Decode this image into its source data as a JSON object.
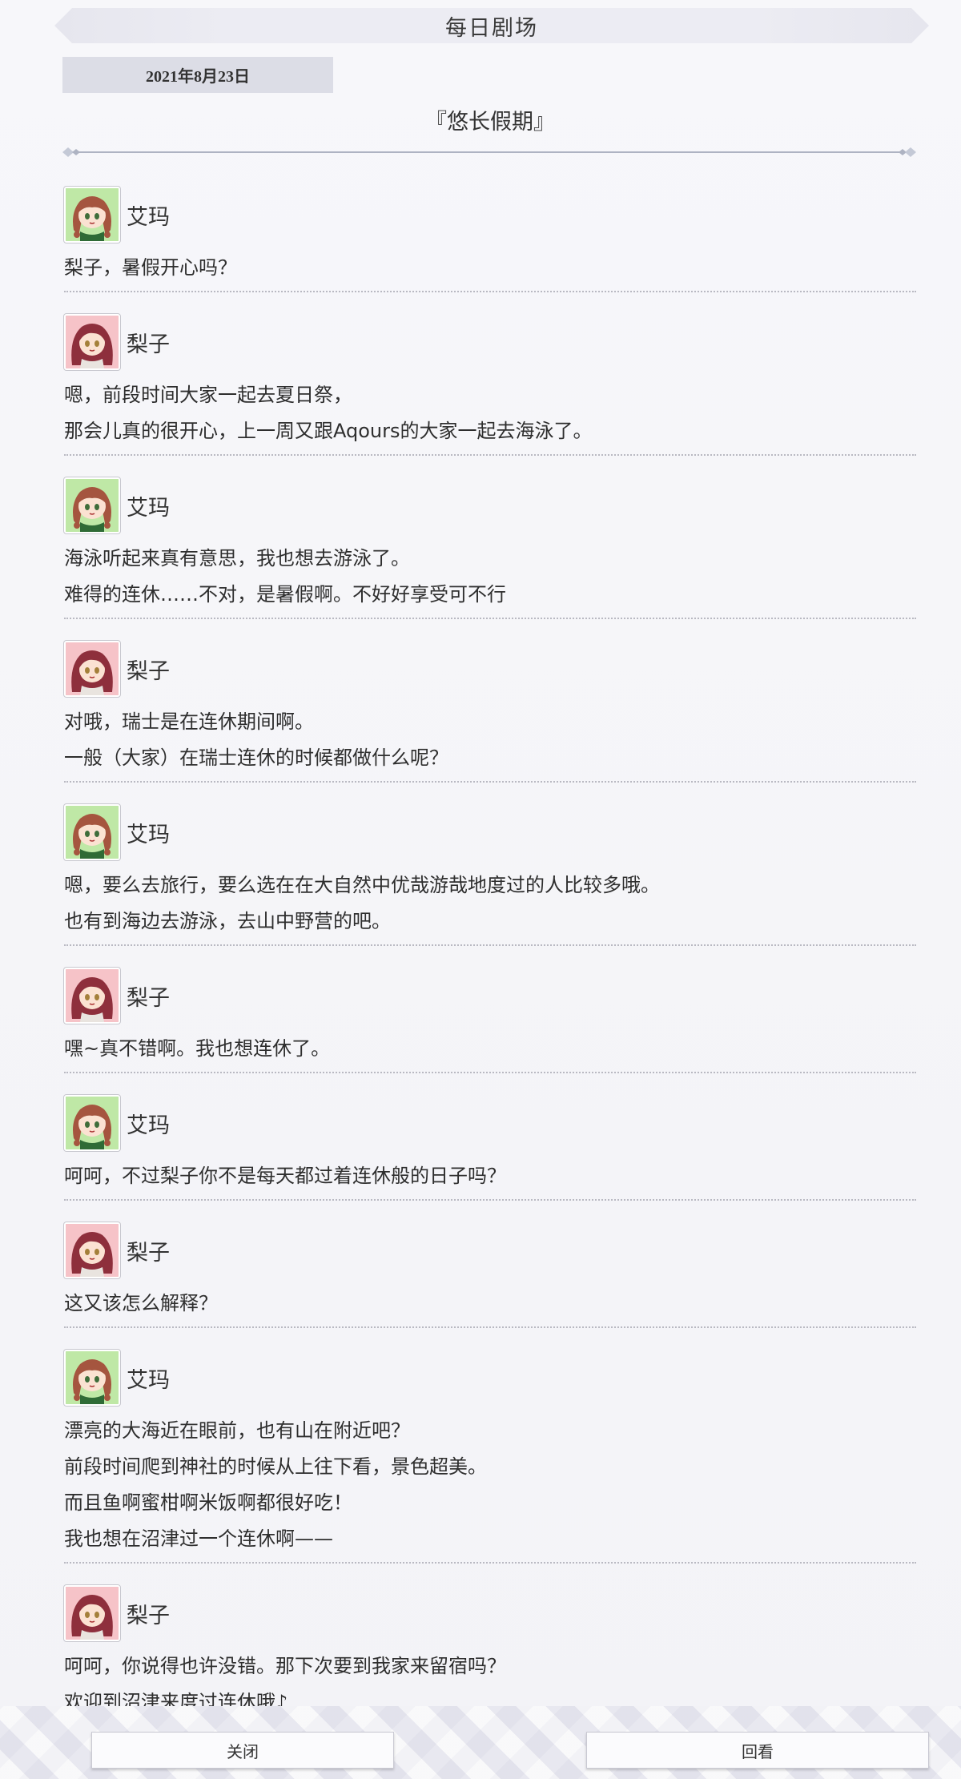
{
  "header": {
    "title": "每日剧场"
  },
  "date": "2021年8月23日",
  "episode_title": "『悠长假期』",
  "colors": {
    "emma_avatar_bg": "#bfe8a6",
    "riko_avatar_bg": "#f6c3c8"
  },
  "entries": [
    {
      "speaker": "艾玛",
      "avatar": "emma-avatar",
      "lines": [
        "梨子，暑假开心吗？"
      ]
    },
    {
      "speaker": "梨子",
      "avatar": "riko-avatar",
      "lines": [
        "嗯，前段时间大家一起去夏日祭，",
        "那会儿真的很开心，上一周又跟Aqours的大家一起去海泳了。"
      ]
    },
    {
      "speaker": "艾玛",
      "avatar": "emma-avatar",
      "lines": [
        "海泳听起来真有意思，我也想去游泳了。",
        "难得的连休……不对，是暑假啊。不好好享受可不行"
      ]
    },
    {
      "speaker": "梨子",
      "avatar": "riko-avatar",
      "lines": [
        "对哦，瑞士是在连休期间啊。",
        "一般（大家）在瑞士连休的时候都做什么呢？"
      ]
    },
    {
      "speaker": "艾玛",
      "avatar": "emma-avatar",
      "lines": [
        "嗯，要么去旅行，要么选在在大自然中优哉游哉地度过的人比较多哦。",
        "也有到海边去游泳，去山中野营的吧。"
      ]
    },
    {
      "speaker": "梨子",
      "avatar": "riko-avatar",
      "lines": [
        "嘿~真不错啊。我也想连休了。"
      ]
    },
    {
      "speaker": "艾玛",
      "avatar": "emma-avatar",
      "lines": [
        "呵呵，不过梨子你不是每天都过着连休般的日子吗？"
      ]
    },
    {
      "speaker": "梨子",
      "avatar": "riko-avatar",
      "lines": [
        "这又该怎么解释？"
      ]
    },
    {
      "speaker": "艾玛",
      "avatar": "emma-avatar",
      "lines": [
        "漂亮的大海近在眼前，也有山在附近吧？",
        "前段时间爬到神社的时候从上往下看，景色超美。",
        "而且鱼啊蜜柑啊米饭啊都很好吃！",
        "我也想在沼津过一个连休啊——"
      ]
    },
    {
      "speaker": "梨子",
      "avatar": "riko-avatar",
      "lines": [
        "呵呵，你说得也许没错。那下次要到我家来留宿吗？",
        "欢迎到沼津来度过连休哦♪"
      ]
    }
  ],
  "footer": {
    "close_label": "关闭",
    "review_label": "回看"
  }
}
